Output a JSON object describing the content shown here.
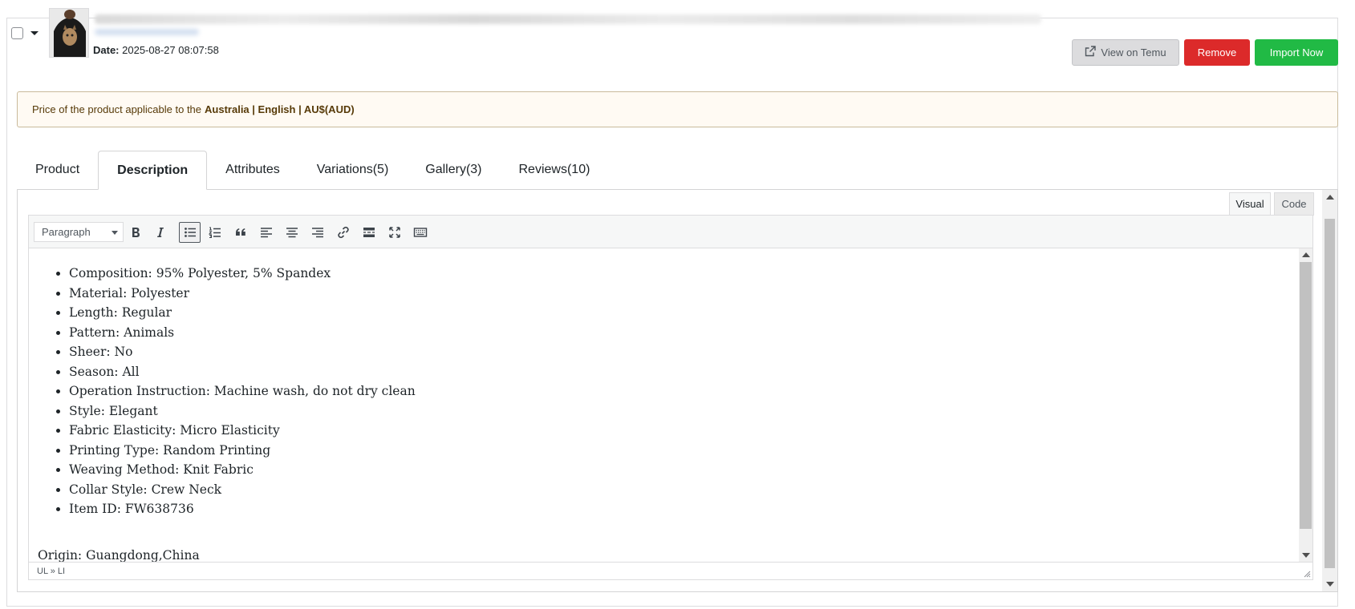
{
  "header": {
    "date_label": "Date:",
    "date_value": "2025-08-27 08:07:58",
    "view_button": "View on Temu",
    "remove_button": "Remove",
    "import_button": "Import Now"
  },
  "notice": {
    "prefix": "Price of the product applicable to the",
    "region": "Australia | English | AU$(AUD)"
  },
  "tabs": [
    {
      "label": "Product"
    },
    {
      "label": "Description"
    },
    {
      "label": "Attributes"
    },
    {
      "label": "Variations(5)"
    },
    {
      "label": "Gallery(3)"
    },
    {
      "label": "Reviews(10)"
    }
  ],
  "active_tab": "Description",
  "editor": {
    "mode_visual": "Visual",
    "mode_code": "Code",
    "active_mode": "Visual",
    "format": "Paragraph",
    "toolbar_icons": [
      "bold-icon",
      "italic-icon",
      "bullet-list-icon",
      "numbered-list-icon",
      "blockquote-icon",
      "align-left-icon",
      "align-center-icon",
      "align-right-icon",
      "link-icon",
      "read-more-icon",
      "fullscreen-icon",
      "toolbar-toggle-icon"
    ],
    "list_items": [
      "Composition: 95% Polyester, 5% Spandex",
      "Material: Polyester",
      "Length: Regular",
      "Pattern: Animals",
      "Sheer: No",
      "Season: All",
      "Operation Instruction: Machine wash, do not dry clean",
      "Style: Elegant",
      "Fabric Elasticity: Micro Elasticity",
      "Printing Type: Random Printing",
      "Weaving Method: Knit Fabric",
      "Collar Style: Crew Neck",
      "Item ID: FW638736"
    ],
    "origin": "Origin: Guangdong,China",
    "status_path": "UL » LI"
  },
  "colors": {
    "remove": "#dc2a2a",
    "import": "#21ba45",
    "view": "#dcdcde",
    "notice_bg": "#fffaf3",
    "notice_text": "#573a08"
  }
}
